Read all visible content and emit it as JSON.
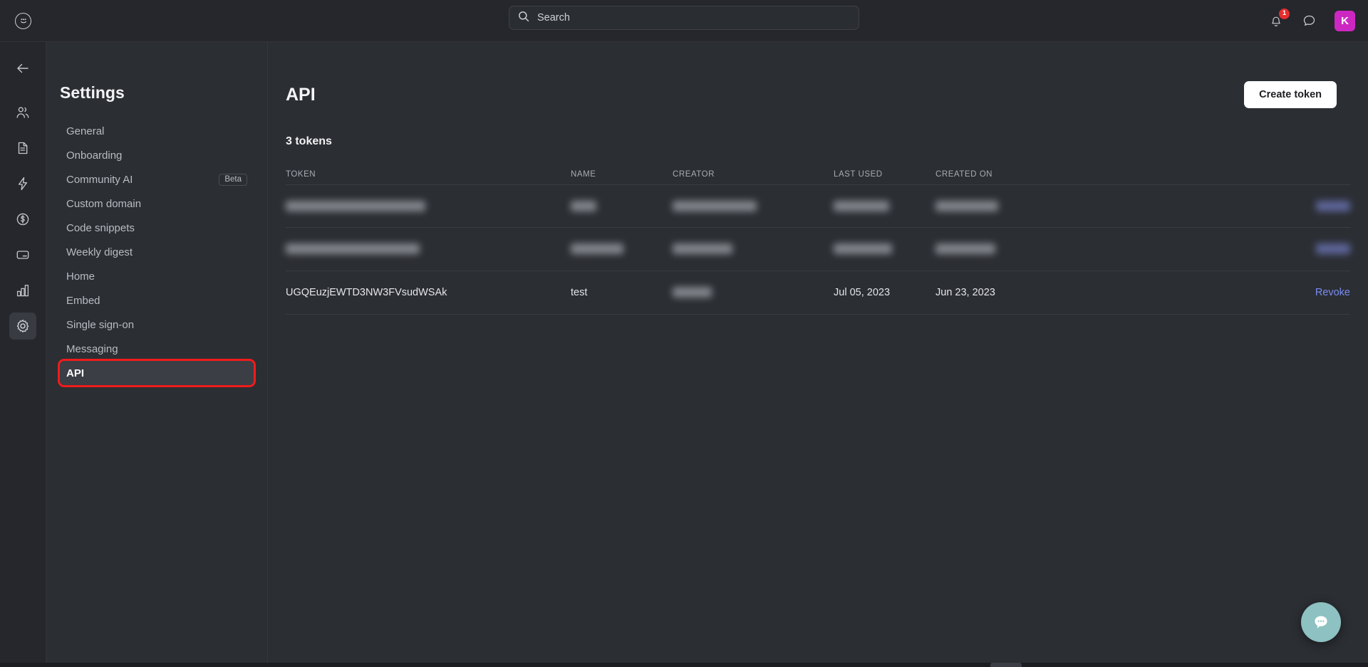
{
  "topbar": {
    "logo_icon": "smiley-face-icon",
    "search": {
      "placeholder": "Search",
      "value": "",
      "icon": "search-icon"
    },
    "notifications": {
      "icon": "bell-icon",
      "badge_count": "1"
    },
    "messages": {
      "icon": "chat-bubble-icon"
    },
    "avatar": {
      "initial": "K",
      "color": "#cc28c1"
    }
  },
  "rail": {
    "items": [
      {
        "name": "home-logo",
        "icon": "smiley-face-icon",
        "active": false
      },
      {
        "name": "back",
        "icon": "arrow-left-icon",
        "active": false
      },
      {
        "name": "members",
        "icon": "people-icon",
        "active": false
      },
      {
        "name": "posts",
        "icon": "document-icon",
        "active": false
      },
      {
        "name": "automations",
        "icon": "lightning-bolt-icon",
        "active": false
      },
      {
        "name": "payments",
        "icon": "dollar-circle-icon",
        "active": false
      },
      {
        "name": "billing",
        "icon": "credit-card-icon",
        "active": false
      },
      {
        "name": "analytics",
        "icon": "bar-chart-icon",
        "active": false
      },
      {
        "name": "settings",
        "icon": "gear-icon",
        "active": true
      }
    ]
  },
  "settings": {
    "title": "Settings",
    "items": [
      {
        "label": "General",
        "badge": null,
        "selected": false
      },
      {
        "label": "Onboarding",
        "badge": null,
        "selected": false
      },
      {
        "label": "Community AI",
        "badge": "Beta",
        "selected": false
      },
      {
        "label": "Custom domain",
        "badge": null,
        "selected": false
      },
      {
        "label": "Code snippets",
        "badge": null,
        "selected": false
      },
      {
        "label": "Weekly digest",
        "badge": null,
        "selected": false
      },
      {
        "label": "Home",
        "badge": null,
        "selected": false
      },
      {
        "label": "Embed",
        "badge": null,
        "selected": false
      },
      {
        "label": "Single sign-on",
        "badge": null,
        "selected": false
      },
      {
        "label": "Messaging",
        "badge": null,
        "selected": false
      },
      {
        "label": "API",
        "badge": null,
        "selected": true
      }
    ],
    "annotation_color": "#f01b1b"
  },
  "main": {
    "page_title": "API",
    "create_button": "Create token",
    "tokens_count_label": "3 tokens",
    "table": {
      "columns": [
        "TOKEN",
        "NAME",
        "CREATOR",
        "LAST USED",
        "CREATED ON",
        ""
      ],
      "rows": [
        {
          "token": "",
          "name": "",
          "creator": "",
          "last_used": "",
          "created_on": "",
          "action": "",
          "redacted": true,
          "redacted_widths": {
            "token": 196,
            "name": 36,
            "creator": 118,
            "last_used": 78,
            "created_on": 88,
            "action": 48
          }
        },
        {
          "token": "",
          "name": "",
          "creator": "",
          "last_used": "",
          "created_on": "",
          "action": "",
          "redacted": true,
          "redacted_widths": {
            "token": 188,
            "name": 74,
            "creator": 84,
            "last_used": 82,
            "created_on": 84,
            "action": 48
          }
        },
        {
          "token": "UGQEuzjEWTD3NW3FVsudWSAk",
          "name": "test",
          "creator": "",
          "last_used": "Jul 05, 2023",
          "created_on": "Jun 23, 2023",
          "action": "Revoke",
          "redacted": false,
          "creator_redacted": true,
          "redacted_widths": {
            "creator": 55
          }
        }
      ]
    },
    "revoke_color": "#7a8cf0"
  },
  "chat_widget": {
    "icon": "chat-dots-icon",
    "color": "#8ec1c1"
  }
}
